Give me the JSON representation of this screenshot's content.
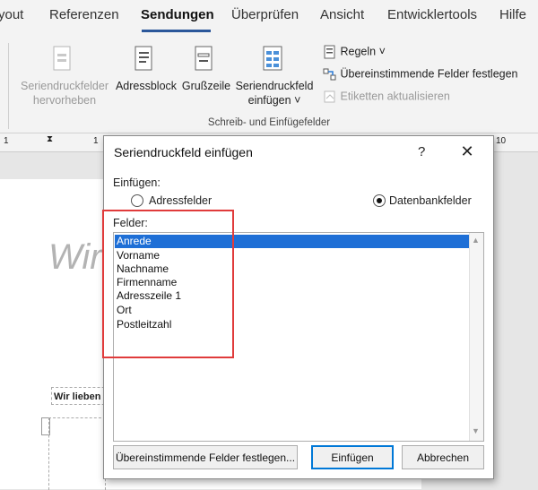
{
  "menu": {
    "tabs": [
      "yout",
      "Referenzen",
      "Sendungen",
      "Überprüfen",
      "Ansicht",
      "Entwicklertools",
      "Hilfe"
    ],
    "active_tab": "Sendungen"
  },
  "ribbon": {
    "highlight_fields": "Seriendruckfelder hervorheben",
    "address_block": "Adressblock",
    "greeting_line": "Grußzeile",
    "insert_merge_field_line1": "Seriendruckfeld",
    "insert_merge_field_line2": "einfügen",
    "rules": "Regeln",
    "match_fields": "Übereinstimmende Felder festlegen",
    "update_labels": "Etiketten aktualisieren",
    "group_label": "Schreib- und Einfügefelder"
  },
  "ruler": {
    "left_mark": "1",
    "center_mark": "1",
    "right_mark": "10"
  },
  "document": {
    "title_fragment": "Wir",
    "box_text": "Wir lieben C"
  },
  "dialog": {
    "title": "Seriendruckfeld einfügen",
    "help": "?",
    "close": "✕",
    "insert_label": "Einfügen:",
    "radio_address": "Adressfelder",
    "radio_database": "Datenbankfelder",
    "selected_radio": "Datenbankfelder",
    "fields_label": "Felder:",
    "fields": [
      "Anrede",
      "Vorname",
      "Nachname",
      "Firmenname",
      "Adresszeile 1",
      "Ort",
      "Postleitzahl"
    ],
    "selected_field": "Anrede",
    "btn_match": "Übereinstimmende Felder festlegen...",
    "btn_insert": "Einfügen",
    "btn_cancel": "Abbrechen"
  },
  "colors": {
    "accent": "#2b579a",
    "selection": "#1e6fd6",
    "highlight_box": "#e03b3b"
  }
}
